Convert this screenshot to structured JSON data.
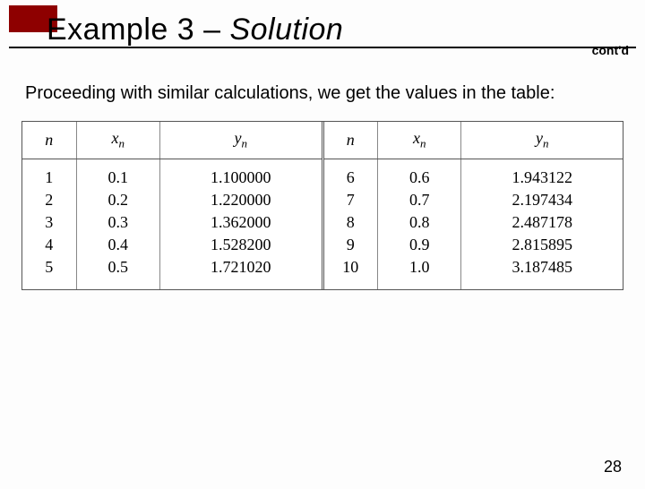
{
  "title_prefix": "Example 3 – ",
  "title_italic": "Solution",
  "contd": "cont'd",
  "body": "Proceeding with similar calculations, we get the values in the table:",
  "headers": {
    "n": "n",
    "xn": "x",
    "xn_sub": "n",
    "yn": "y",
    "yn_sub": "n"
  },
  "chart_data": {
    "type": "table",
    "title": "Euler's method iteration table",
    "columns": [
      "n",
      "x_n",
      "y_n"
    ],
    "left": [
      {
        "n": "1",
        "xn": "0.1",
        "yn": "1.100000"
      },
      {
        "n": "2",
        "xn": "0.2",
        "yn": "1.220000"
      },
      {
        "n": "3",
        "xn": "0.3",
        "yn": "1.362000"
      },
      {
        "n": "4",
        "xn": "0.4",
        "yn": "1.528200"
      },
      {
        "n": "5",
        "xn": "0.5",
        "yn": "1.721020"
      }
    ],
    "right": [
      {
        "n": "6",
        "xn": "0.6",
        "yn": "1.943122"
      },
      {
        "n": "7",
        "xn": "0.7",
        "yn": "2.197434"
      },
      {
        "n": "8",
        "xn": "0.8",
        "yn": "2.487178"
      },
      {
        "n": "9",
        "xn": "0.9",
        "yn": "2.815895"
      },
      {
        "n": "10",
        "xn": "1.0",
        "yn": "3.187485"
      }
    ]
  },
  "page_number": "28"
}
